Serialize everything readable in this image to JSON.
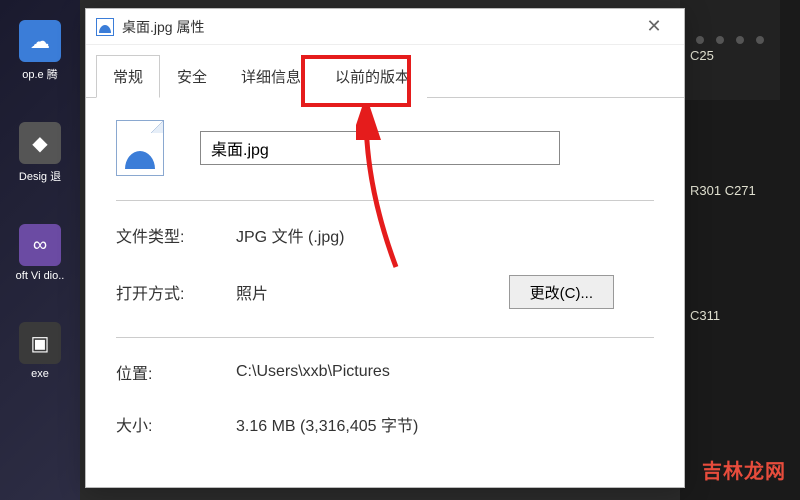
{
  "desktop": {
    "icons": [
      {
        "label": "op.e 腾"
      },
      {
        "label": "Desig 退"
      },
      {
        "label": "oft Vi dio.."
      },
      {
        "label": "exe"
      }
    ]
  },
  "mobo": {
    "labels": [
      "C25",
      "R301 C271",
      "C311"
    ]
  },
  "dialog": {
    "title": "桌面.jpg 属性",
    "close": "✕",
    "tabs": {
      "general": "常规",
      "security": "安全",
      "details": "详细信息",
      "previous": "以前的版本",
      "highlighted": "details"
    },
    "filename": "桌面.jpg",
    "properties": {
      "filetype_label": "文件类型:",
      "filetype_value": "JPG 文件 (.jpg)",
      "openwith_label": "打开方式:",
      "openwith_value": "照片",
      "change_btn": "更改(C)...",
      "location_label": "位置:",
      "location_value": "C:\\Users\\xxb\\Pictures",
      "size_label": "大小:",
      "size_value": "3.16 MB (3,316,405 字节)"
    }
  },
  "watermark": "吉林龙网"
}
